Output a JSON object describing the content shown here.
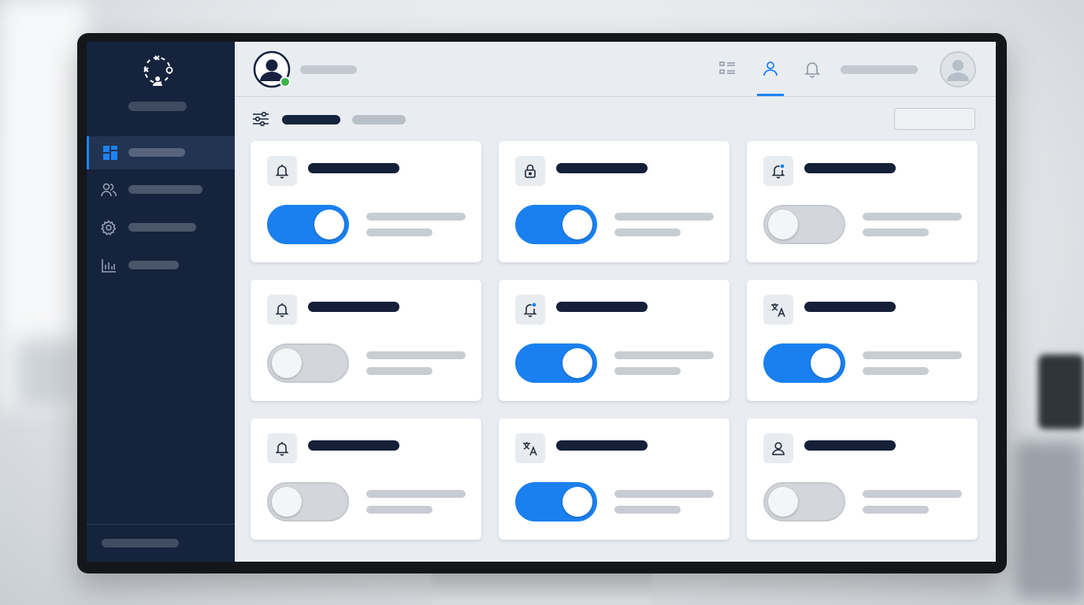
{
  "colors": {
    "accent": "#1a80f0",
    "sidebar_bg": "#15233d",
    "status_online": "#3bb54a",
    "toggle_off": "#d3d6da"
  },
  "sidebar": {
    "logo_icon": "team-network-icon",
    "items": [
      {
        "icon": "dashboard-grid-icon",
        "active": true
      },
      {
        "icon": "users-icon",
        "active": false
      },
      {
        "icon": "gear-icon",
        "active": false
      },
      {
        "icon": "bar-chart-icon",
        "active": false
      }
    ]
  },
  "header": {
    "avatar_status": "online",
    "nav_icons": [
      "list-view-icon",
      "user-icon",
      "bell-icon"
    ],
    "active_nav": "user-icon"
  },
  "toolbar": {
    "filter_icon": "sliders-icon"
  },
  "settings": [
    {
      "icon": "bell-icon",
      "enabled": true
    },
    {
      "icon": "lock-icon",
      "enabled": true
    },
    {
      "icon": "bell-badge-icon",
      "enabled": false
    },
    {
      "icon": "bell-icon",
      "enabled": false
    },
    {
      "icon": "bell-badge-icon",
      "enabled": true
    },
    {
      "icon": "translate-icon",
      "enabled": true
    },
    {
      "icon": "bell-icon",
      "enabled": false
    },
    {
      "icon": "translate-icon",
      "enabled": true
    },
    {
      "icon": "user-icon",
      "enabled": false
    }
  ]
}
